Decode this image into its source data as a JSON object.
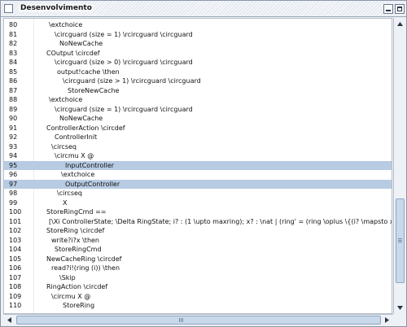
{
  "window": {
    "title": "Desenvolvimento"
  },
  "editor": {
    "lines": [
      {
        "n": "80",
        "code": "\\extchoice"
      },
      {
        "n": "81",
        "code": "\\circguard (size = 1) \\rcircguard \\circguard"
      },
      {
        "n": "82",
        "code": "NoNewCache"
      },
      {
        "n": "83",
        "code": "COutput \\circdef"
      },
      {
        "n": "84",
        "code": "\\circguard (size > 0) \\rcircguard \\circguard"
      },
      {
        "n": "85",
        "code": "output!cache \\then"
      },
      {
        "n": "86",
        "code": "\\circguard (size > 1) \\rcircguard \\circguard"
      },
      {
        "n": "87",
        "code": "StoreNewCache"
      },
      {
        "n": "88",
        "code": "\\extchoice"
      },
      {
        "n": "89",
        "code": "\\circguard (size = 1) \\rcircguard \\circguard"
      },
      {
        "n": "90",
        "code": "NoNewCache"
      },
      {
        "n": "91",
        "code": "ControllerAction \\circdef"
      },
      {
        "n": "92",
        "code": "ControllerInit"
      },
      {
        "n": "93",
        "code": "\\circseq"
      },
      {
        "n": "94",
        "code": "\\circmu X @"
      },
      {
        "n": "95",
        "code": "InputController"
      },
      {
        "n": "96",
        "code": "\\extchoice"
      },
      {
        "n": "97",
        "code": "OutputController"
      },
      {
        "n": "98",
        "code": "\\circseq"
      },
      {
        "n": "99",
        "code": "X"
      },
      {
        "n": "100",
        "code": "StoreRingCmd =="
      },
      {
        "n": "101",
        "code": "[\\Xi ControllerState; \\Delta RingState; i? : (1 \\upto maxring); x? : \\nat | (ring' = (ring \\oplus \\{(i? \\mapsto x?)\\})) ]"
      },
      {
        "n": "102",
        "code": "StoreRing \\circdef"
      },
      {
        "n": "103",
        "code": "write?i?x \\then"
      },
      {
        "n": "104",
        "code": "StoreRingCmd"
      },
      {
        "n": "105",
        "code": "NewCacheRing \\circdef"
      },
      {
        "n": "106",
        "code": "read?i!(ring (i)) \\then"
      },
      {
        "n": "107",
        "code": "\\Skip"
      },
      {
        "n": "108",
        "code": "RingAction \\circdef"
      },
      {
        "n": "109",
        "code": "\\circmu X @"
      },
      {
        "n": "110",
        "code": "StoreRing"
      }
    ]
  },
  "colors": {
    "selection": "#b7cbe3",
    "scroll_thumb": "#c9d8ea",
    "title_bar": "#dfe5ee"
  },
  "icons": {
    "title_checkbox": "checkbox-icon",
    "minimize": "minimize-icon",
    "maximize": "maximize-icon",
    "scroll_up": "arrow-up-icon",
    "scroll_down": "arrow-down-icon",
    "scroll_left": "arrow-left-icon",
    "scroll_right": "arrow-right-icon"
  }
}
